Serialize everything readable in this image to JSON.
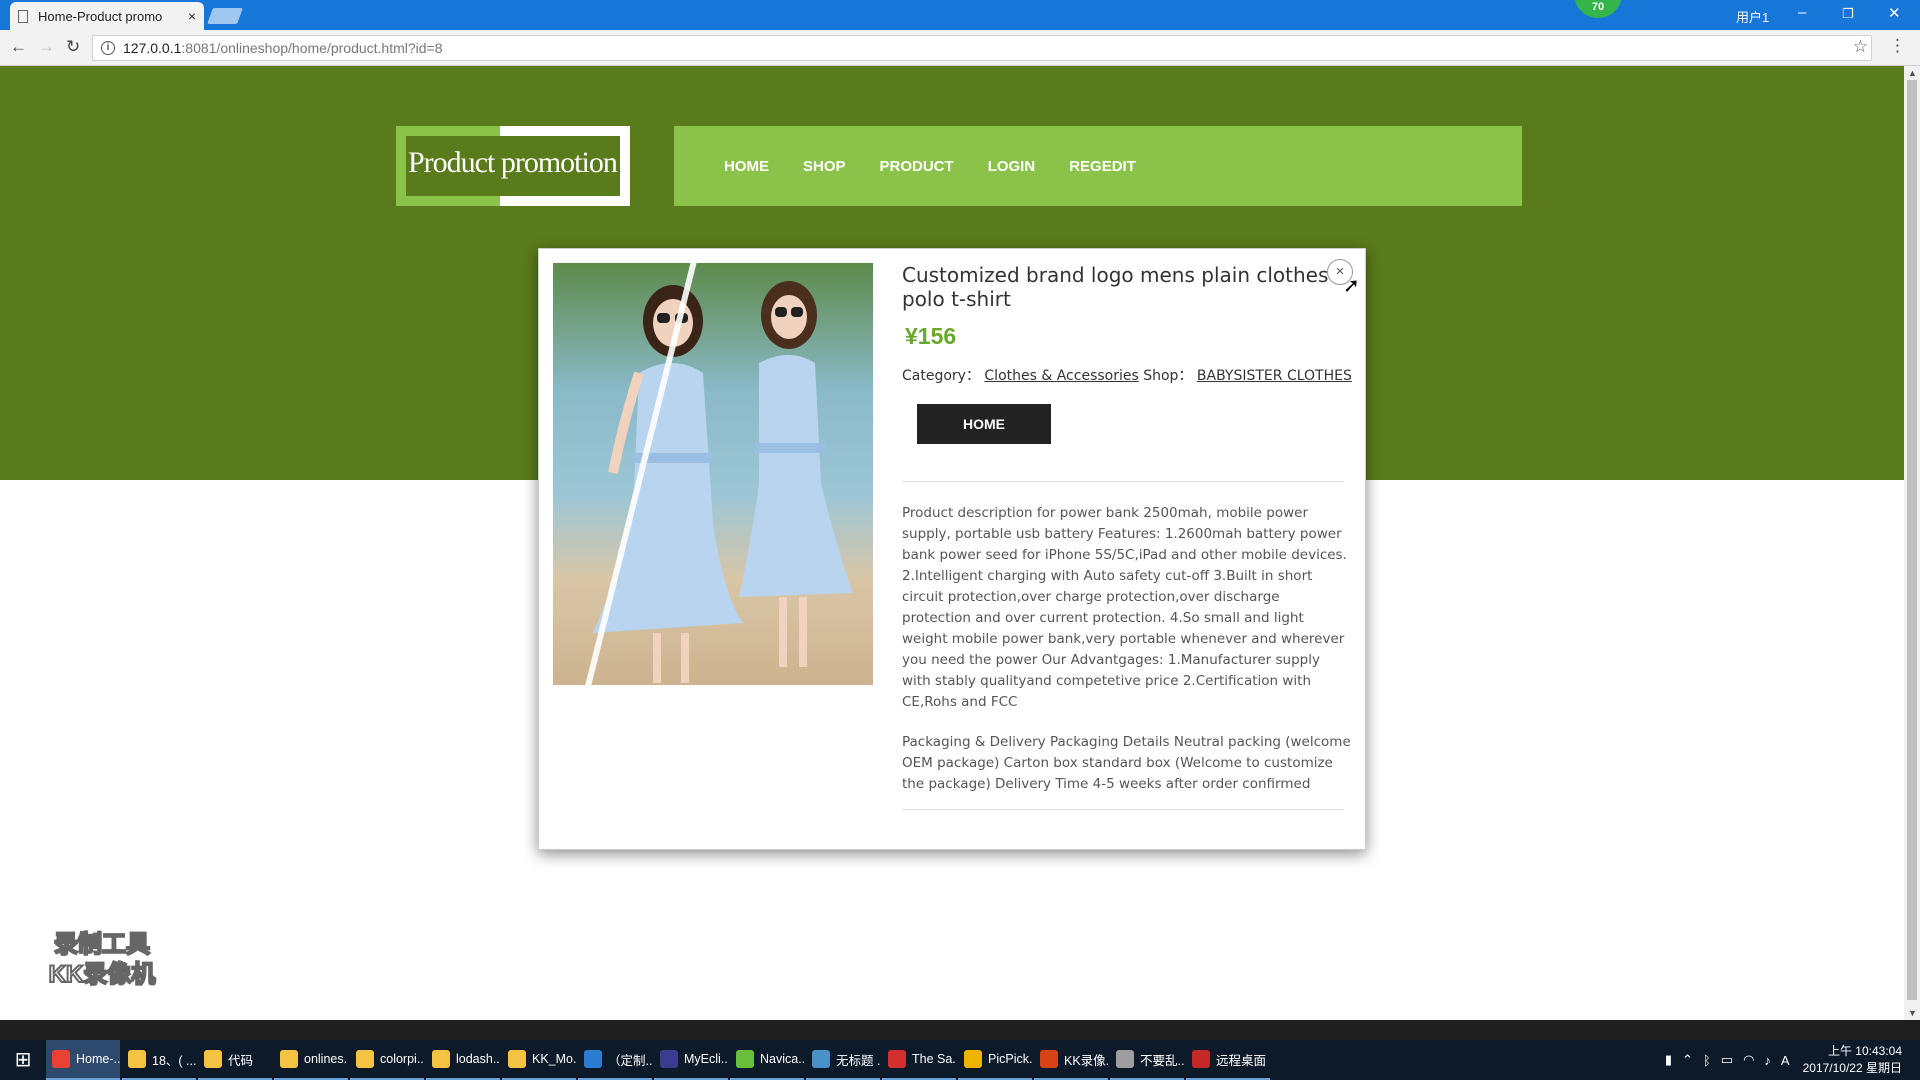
{
  "browser": {
    "tab_title": "Home-Product promo",
    "tab_close": "×",
    "url_host": "127.0.0.1",
    "url_path": ":8081/onlineshop/home/product.html?id=8",
    "badge": "70",
    "user_label": "用户1",
    "minimize": "–",
    "restore": "❐",
    "close": "✕"
  },
  "site": {
    "logo": "Product promotion",
    "menu": [
      "HOME",
      "SHOP",
      "PRODUCT",
      "LOGIN",
      "REGEDIT"
    ]
  },
  "modal": {
    "title": "Customized brand logo mens plain clothes polo t-shirt",
    "price": "¥156",
    "category_label": "Category：",
    "category_value": "Clothes & Accessories",
    "shop_label": "Shop：",
    "shop_value": "BABYSISTER CLOTHES",
    "button": "HOME",
    "close_glyph": "×",
    "description": "Product description for power bank 2500mah, mobile power supply, portable usb battery Features: 1.2600mah battery power bank power seed for iPhone 5S/5C,iPad and other mobile devices. 2.Intelligent charging with Auto safety cut-off 3.Built in short circuit protection,over charge protection,over discharge protection and over current protection. 4.So small and light weight mobile power bank,very portable whenever and wherever you need the power Our Advantgages: 1.Manufacturer supply with stably qualityand competetive price 2.Certification with CE,Rohs and FCC",
    "packaging": "Packaging & Delivery Packaging Details Neutral packing (welcome OEM package) Carton box standard box (Welcome to customize the package) Delivery Time 4-5 weeks after order confirmed"
  },
  "watermark": {
    "line1": "录制工具",
    "line2": "KK录像机"
  },
  "taskbar": {
    "items": [
      {
        "label": "Home-...",
        "color": "#e94235"
      },
      {
        "label": "18、( ...",
        "color": "#f5c342"
      },
      {
        "label": "代码",
        "color": "#f5c342"
      },
      {
        "label": "onlines...",
        "color": "#f5c342"
      },
      {
        "label": "colorpi...",
        "color": "#f5c342"
      },
      {
        "label": "lodash....",
        "color": "#f5c342"
      },
      {
        "label": "KK_Mo...",
        "color": "#f5c342"
      },
      {
        "label": "（定制...",
        "color": "#2b7cd3"
      },
      {
        "label": "MyEcli...",
        "color": "#3b3b8f"
      },
      {
        "label": "Navica...",
        "color": "#6abf3a"
      },
      {
        "label": "无标题 ...",
        "color": "#4a90c8"
      },
      {
        "label": "The Sa...",
        "color": "#d32f2f"
      },
      {
        "label": "PicPick...",
        "color": "#f0b400"
      },
      {
        "label": "KK录像...",
        "color": "#d84315"
      },
      {
        "label": "不要乱...",
        "color": "#9e9e9e"
      },
      {
        "label": "远程桌面",
        "color": "#c62828"
      }
    ],
    "time": "上午 10:43:04",
    "date": "2017/10/22 星期日"
  }
}
